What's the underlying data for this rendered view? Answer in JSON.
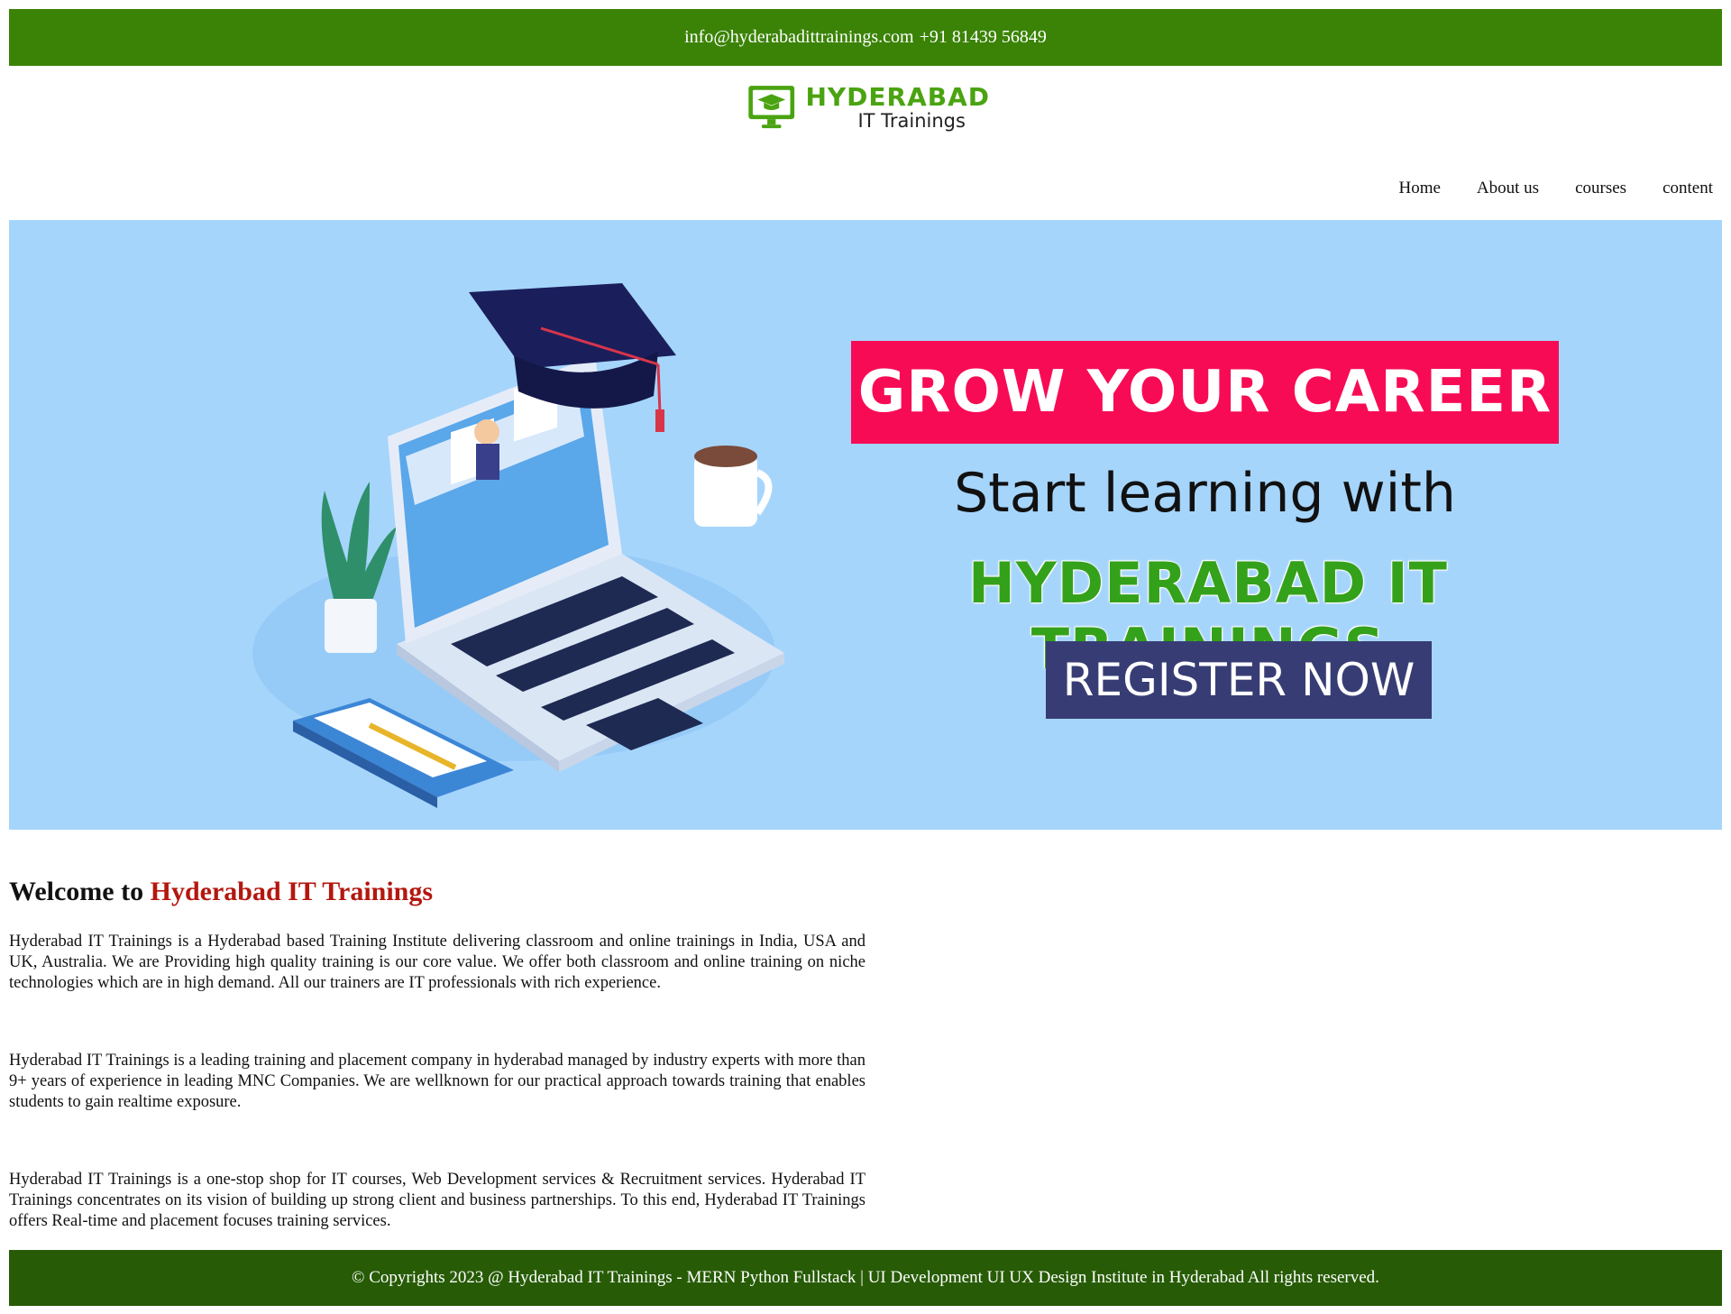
{
  "header": {
    "email": "info@hyderabadittrainings.com",
    "phone": "+91 81439 56849"
  },
  "logo": {
    "line1": "HYDERABAD",
    "line2": "IT Trainings"
  },
  "nav": {
    "items": [
      "Home",
      "About us",
      "courses",
      "content"
    ]
  },
  "banner": {
    "headline": "GROW YOUR CAREER",
    "subline": "Start learning with",
    "brand": "HYDERABAD IT TRAININGS",
    "cta": "REGISTER NOW"
  },
  "main": {
    "welcome_prefix": "Welcome to",
    "welcome_highlight": "Hyderabad IT Trainings",
    "paragraphs": [
      "Hyderabad IT Trainings is a Hyderabad based Training Institute delivering classroom and online trainings in India, USA and UK, Australia. We are Providing high quality training is our core value. We offer both classroom and online training on niche technologies which are in high demand. All our trainers are IT professionals with rich experience.",
      "Hyderabad IT Trainings is a leading training and placement company in hyderabad managed by industry experts with more than 9+ years of experience in leading MNC Companies. We are wellknown for our practical approach towards training that enables students to gain realtime exposure.",
      "Hyderabad IT Trainings is a one-stop shop for IT courses, Web Development services & Recruitment services. Hyderabad IT Trainings concentrates on its vision of building up strong client and business partnerships. To this end, Hyderabad IT Trainings offers Real-time and placement focuses training services."
    ]
  },
  "footer": {
    "text": "© Copyrights 2023 @ Hyderabad IT Trainings - MERN Python Fullstack | UI Development UI UX Design Institute in Hyderabad All rights reserved."
  },
  "colors": {
    "topbar": "#3b8306",
    "footer": "#275b06",
    "banner_bg": "#a6d5fc",
    "headline_bg": "#f80b55",
    "brand_green": "#34a11a",
    "cta_bg": "#373d74",
    "welcome_highlight": "#b4170f"
  }
}
